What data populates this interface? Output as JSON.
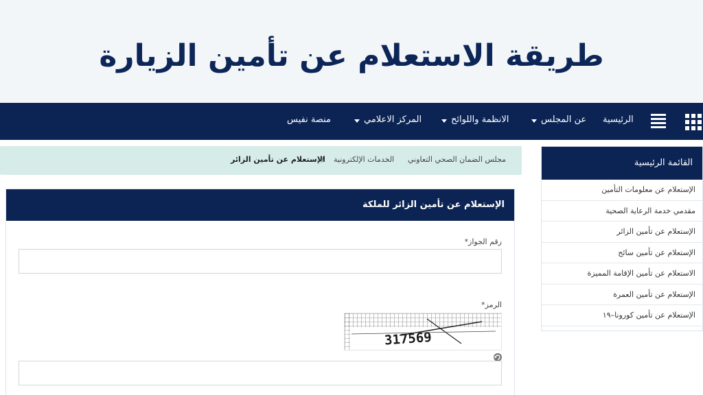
{
  "banner": {
    "title": "طريقة الاستعلام عن تأمين الزيارة"
  },
  "nav": {
    "home": "الرئيسية",
    "about": "عن المجلس",
    "regulations": "الانظمة واللوائح",
    "media": "المركز الاعلامي",
    "nafees": "منصة نفيس"
  },
  "breadcrumb": {
    "root": "مجلس الضمان الصحي التعاوني",
    "services": "الخدمات الإلكترونية",
    "separator": "/",
    "current": "الإستعلام عن تأمين الزائر"
  },
  "form": {
    "title": "الإستعلام عن تأمين الزائر للملكة",
    "passport_label": "رقم الجواز*",
    "code_label": "الرمز*",
    "captcha_text": "317569",
    "passport_value": "",
    "code_value": ""
  },
  "sidebar": {
    "title": "القائمة الرئيسية",
    "items": [
      "الإستعلام عن معلومات التأمين",
      "مقدمي خدمة الرعاية الصحية",
      "الإستعلام عن تأمين الزائر",
      "الإستعلام عن تأمين سائح",
      "الاستعلام عن تأمين الإقامة المميزة",
      "الإستعلام عن تأمين العمرة",
      "الإستعلام عن تأمين كورونا–١٩"
    ]
  },
  "colors": {
    "primary": "#0b2454",
    "breadcrumb_bg": "#d6ece8",
    "banner_bg": "#f3f6f8"
  }
}
